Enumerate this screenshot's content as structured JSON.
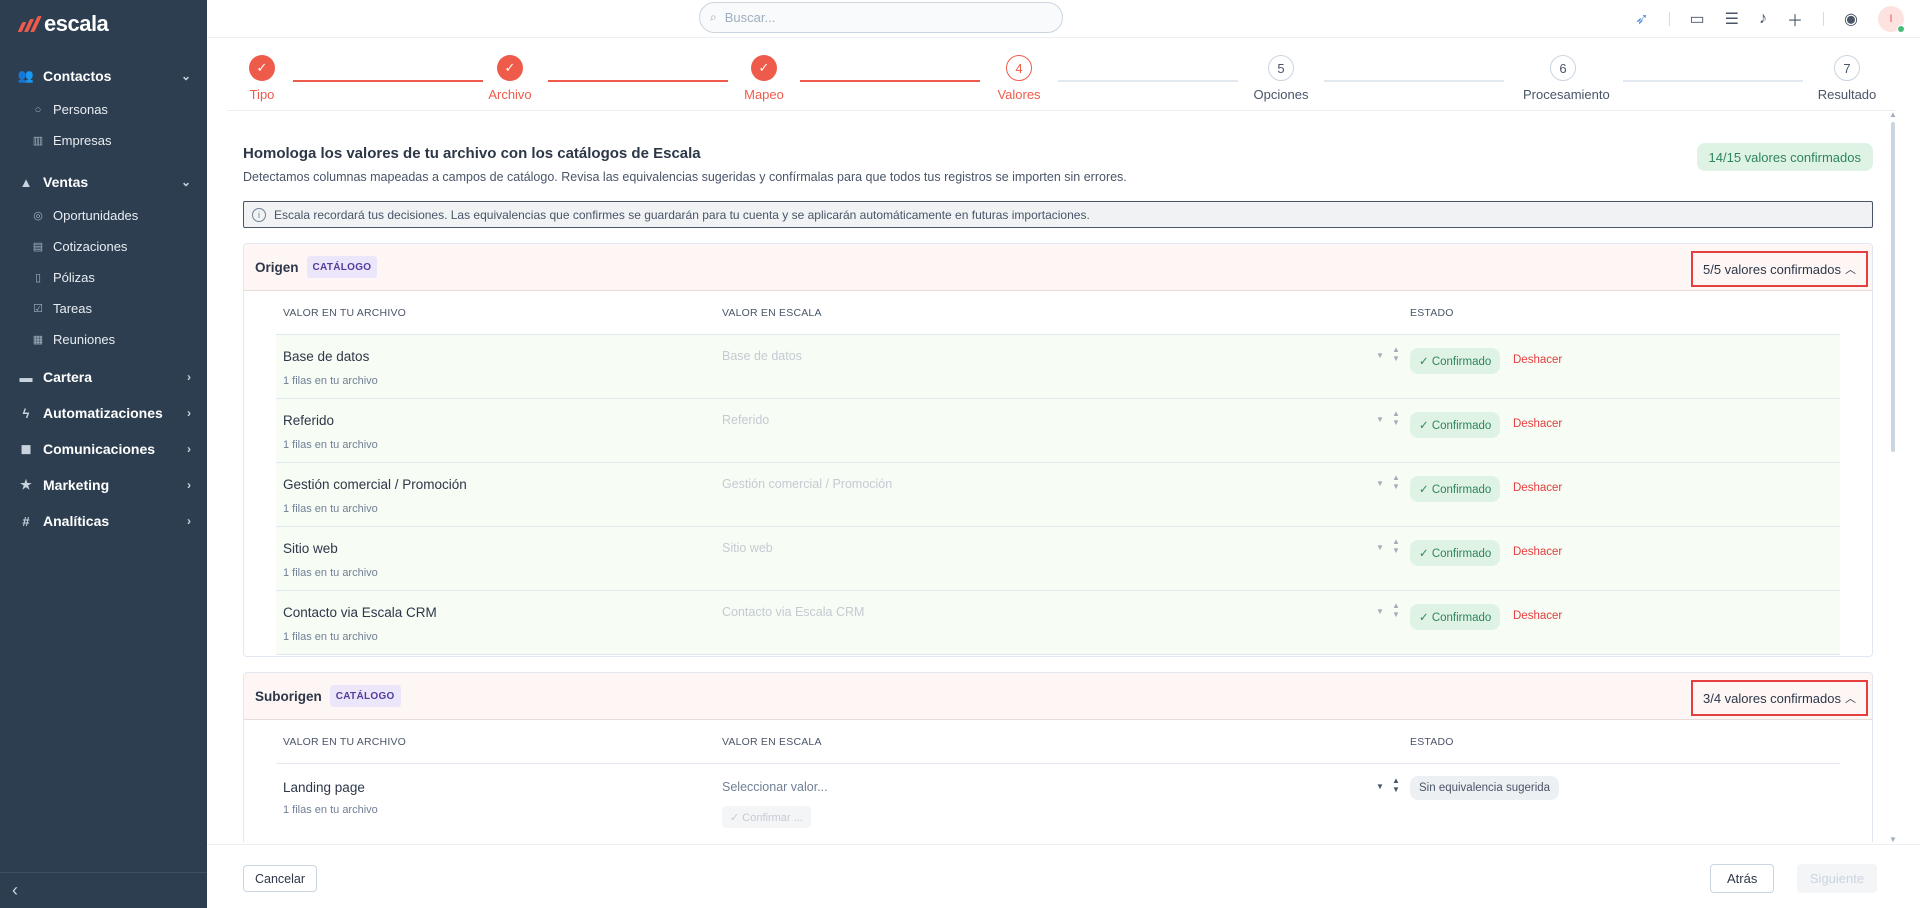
{
  "app": {
    "logo": "escala"
  },
  "search": {
    "placeholder": "Buscar..."
  },
  "sidebar": {
    "groups": [
      {
        "label": "Contactos",
        "children": [
          "Personas",
          "Empresas"
        ]
      },
      {
        "label": "Ventas",
        "children": [
          "Oportunidades",
          "Cotizaciones",
          "Pólizas",
          "Tareas",
          "Reuniones"
        ]
      },
      {
        "label": "Cartera"
      },
      {
        "label": "Automatizaciones"
      },
      {
        "label": "Comunicaciones"
      },
      {
        "label": "Marketing"
      },
      {
        "label": "Analíticas"
      }
    ],
    "collapse_icon": "chevron-left-icon"
  },
  "topbar": {
    "avatar_initial": "I"
  },
  "stepper": {
    "steps": [
      {
        "num": "✓",
        "label": "Tipo",
        "state": "done"
      },
      {
        "num": "✓",
        "label": "Archivo",
        "state": "done"
      },
      {
        "num": "✓",
        "label": "Mapeo",
        "state": "done"
      },
      {
        "num": "4",
        "label": "Valores",
        "state": "active"
      },
      {
        "num": "5",
        "label": "Opciones",
        "state": "todo"
      },
      {
        "num": "6",
        "label": "Procesamiento",
        "state": "todo"
      },
      {
        "num": "7",
        "label": "Resultado",
        "state": "todo"
      }
    ]
  },
  "main": {
    "title": "Homologa los valores de tu archivo con los catálogos de Escala",
    "description": "Detectamos columnas mapeadas a campos de catálogo. Revisa las equivalencias sugeridas y confírmalas para que todos tus registros se importen sin errores.",
    "total_confirmed": "14/15 valores confirmados",
    "info": "Escala recordará tus decisiones. Las equivalencias que confirmes se guardarán para tu cuenta y se aplicarán automáticamente en futuras importaciones."
  },
  "table_headers": {
    "file_value": "VALOR EN TU ARCHIVO",
    "escala_value": "VALOR EN ESCALA",
    "status": "ESTADO"
  },
  "sections": [
    {
      "title": "Origen",
      "badge": "CATÁLOGO",
      "count": "5/5 valores confirmados",
      "rows": [
        {
          "name": "Base de datos",
          "sub": "1 filas en tu archivo",
          "value": "Base de datos",
          "status": "✓ Confirmado",
          "action": "Deshacer"
        },
        {
          "name": "Referido",
          "sub": "1 filas en tu archivo",
          "value": "Referido",
          "status": "✓ Confirmado",
          "action": "Deshacer"
        },
        {
          "name": "Gestión comercial / Promoción",
          "sub": "1 filas en tu archivo",
          "value": "Gestión comercial / Promoción",
          "status": "✓ Confirmado",
          "action": "Deshacer"
        },
        {
          "name": "Sitio web",
          "sub": "1 filas en tu archivo",
          "value": "Sitio web",
          "status": "✓ Confirmado",
          "action": "Deshacer"
        },
        {
          "name": "Contacto via Escala CRM",
          "sub": "1 filas en tu archivo",
          "value": "Contacto via Escala CRM",
          "status": "✓ Confirmado",
          "action": "Deshacer"
        }
      ]
    },
    {
      "title": "Suborigen",
      "badge": "CATÁLOGO",
      "count": "3/4 valores confirmados",
      "rows": [
        {
          "name": "Landing page",
          "sub": "1 filas en tu archivo",
          "value": "Seleccionar valor...",
          "status": "Sin equivalencia sugerida",
          "confirm": "✓ Confirmar ..."
        }
      ]
    }
  ],
  "footer": {
    "cancel": "Cancelar",
    "back": "Atrás",
    "next": "Siguiente"
  },
  "colors": {
    "accent": "#ef5b4b",
    "sidebar": "#2d3e50",
    "success": "#2f855a",
    "danger": "#e53e3e"
  }
}
